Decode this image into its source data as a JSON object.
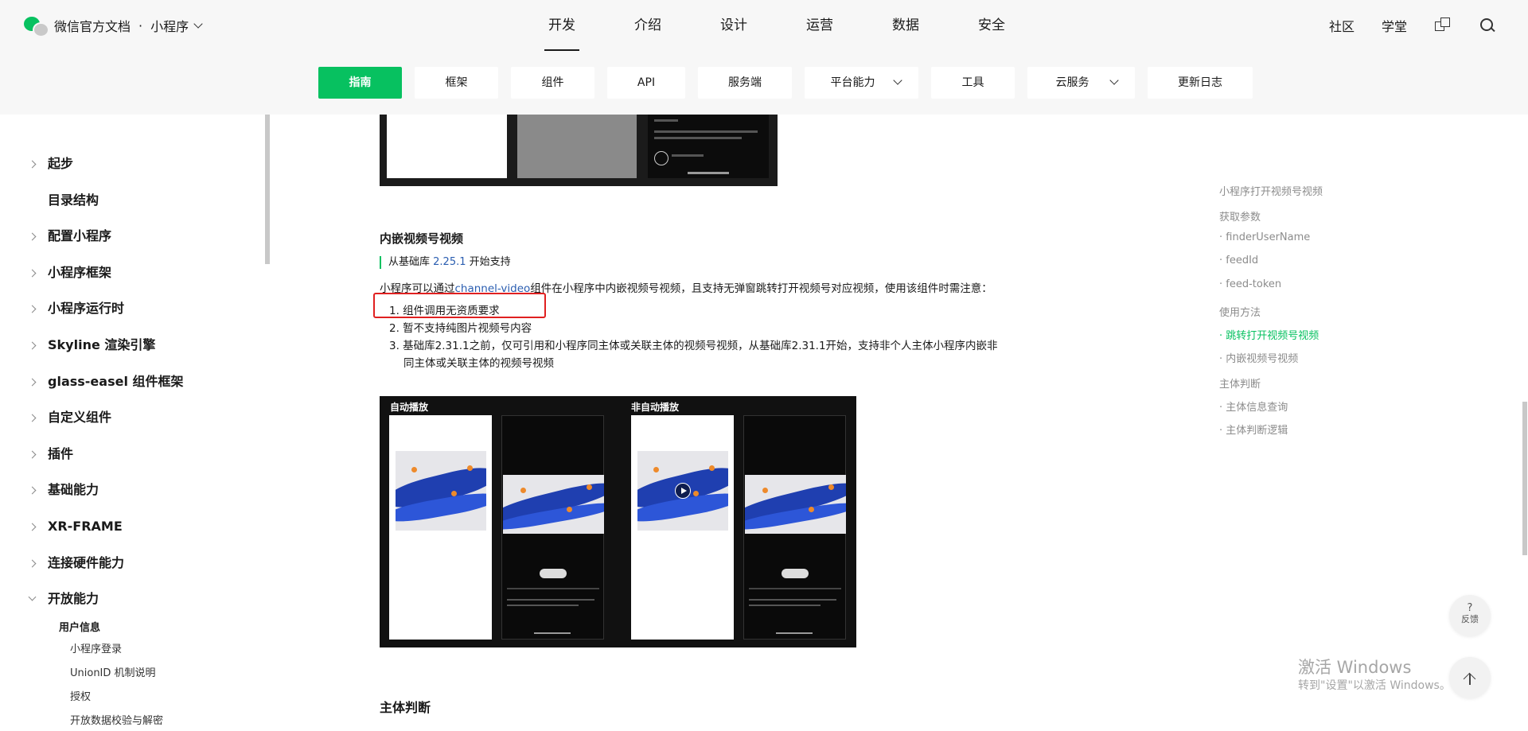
{
  "header": {
    "brand": "微信官方文档",
    "dot": "·",
    "product": "小程序",
    "nav": [
      {
        "label": "开发",
        "active": true
      },
      {
        "label": "介绍"
      },
      {
        "label": "设计"
      },
      {
        "label": "运营"
      },
      {
        "label": "数据"
      },
      {
        "label": "安全"
      }
    ],
    "community": "社区",
    "academy": "学堂"
  },
  "subnav": {
    "tabs": [
      {
        "label": "指南",
        "active": true
      },
      {
        "label": "框架"
      },
      {
        "label": "组件"
      },
      {
        "label": "API"
      },
      {
        "label": "服务端"
      },
      {
        "label": "平台能力",
        "dropdown": true
      },
      {
        "label": "工具"
      },
      {
        "label": "云服务",
        "dropdown": true
      },
      {
        "label": "更新日志"
      }
    ]
  },
  "sidebar": {
    "items": [
      {
        "label": "起步",
        "arrow": true
      },
      {
        "label": "目录结构",
        "arrow": false
      },
      {
        "label": "配置小程序",
        "arrow": true
      },
      {
        "label": "小程序框架",
        "arrow": true
      },
      {
        "label": "小程序运行时",
        "arrow": true
      },
      {
        "label": "Skyline 渲染引擎",
        "arrow": true
      },
      {
        "label": "glass-easel 组件框架",
        "arrow": true
      },
      {
        "label": "自定义组件",
        "arrow": true
      },
      {
        "label": "插件",
        "arrow": true
      },
      {
        "label": "基础能力",
        "arrow": true
      },
      {
        "label": "XR-FRAME",
        "arrow": true
      },
      {
        "label": "连接硬件能力",
        "arrow": true
      },
      {
        "label": "开放能力",
        "arrow": true,
        "open": true
      }
    ],
    "group": "用户信息",
    "subitems": [
      "小程序登录",
      "UnionID 机制说明",
      "授权",
      "开放数据校验与解密"
    ]
  },
  "content": {
    "heading": "内嵌视频号视频",
    "support_prefix": "从基础库",
    "support_version": "2.25.1",
    "support_suffix": "开始支持",
    "para_prefix": "小程序可以通过",
    "para_link": "channel-video",
    "para_suffix": "组件在小程序中内嵌视频号视频，且支持无弹窗跳转打开视频号对应视频，使用该组件时需注意：",
    "list": [
      "1. 组件调用无资质要求",
      "2. 暂不支持纯图片视频号内容",
      "3. 基础库2.31.1之前，仅可引用和小程序同主体或关联主体的视频号视频，从基础库2.31.1开始，支持非个人主体小程序内嵌非同主体或关联主体的视频号视频"
    ],
    "demo_label_auto": "自动播放",
    "demo_label_manual": "非自动播放",
    "next_heading": "主体判断"
  },
  "toc": {
    "items": [
      {
        "label": "小程序打开视频号视频"
      },
      {
        "label": "获取参数"
      },
      {
        "label": "· finderUserName"
      },
      {
        "label": "· feedId"
      },
      {
        "label": "· feed-token"
      },
      {
        "label": "使用方法"
      },
      {
        "label": "· 跳转打开视频号视频",
        "active": true
      },
      {
        "label": "· 内嵌视频号视频"
      },
      {
        "label": "主体判断"
      },
      {
        "label": "· 主体信息查询"
      },
      {
        "label": "· 主体判断逻辑"
      }
    ]
  },
  "float": {
    "help_mark": "?",
    "feedback": "反馈"
  },
  "watermark": {
    "line1": "激活 Windows",
    "line2": "转到\"设置\"以激活 Windows。"
  },
  "colors": {
    "accent": "#07c160",
    "link": "#2a5db0",
    "highlight_box": "#e02020"
  }
}
